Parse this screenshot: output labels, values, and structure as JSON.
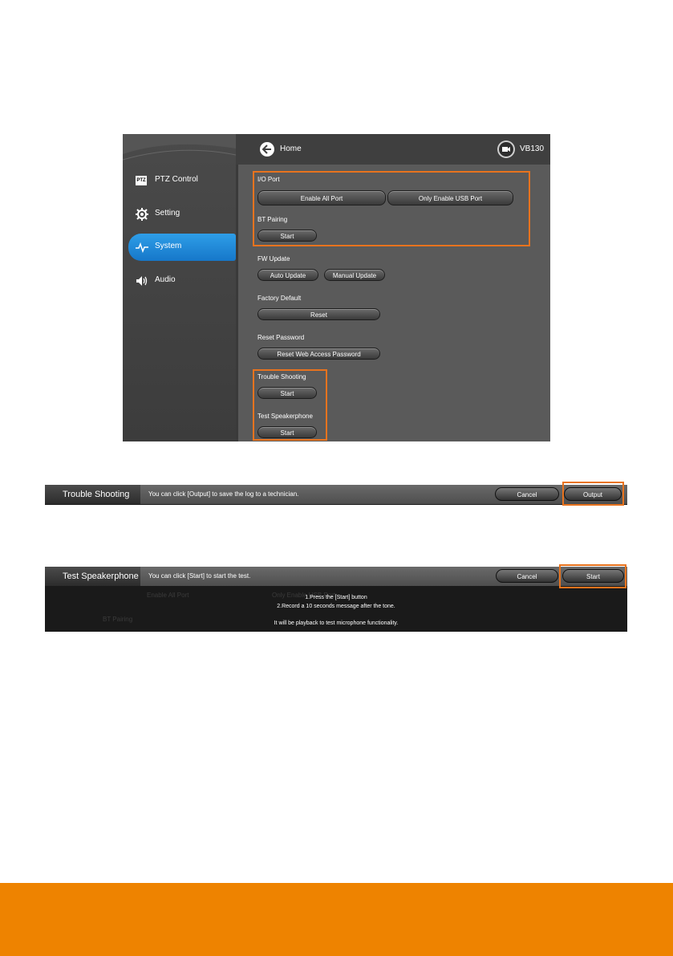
{
  "app": {
    "sidebar": {
      "items": [
        {
          "label": "PTZ Control",
          "icon": "ptz-icon"
        },
        {
          "label": "Setting",
          "icon": "gear-icon"
        },
        {
          "label": "System",
          "icon": "pulse-icon",
          "active": true
        },
        {
          "label": "Audio",
          "icon": "speaker-icon"
        }
      ],
      "ptz_badge": "PTZ"
    },
    "topbar": {
      "home_label": "Home",
      "model": "VB130"
    },
    "io_port": {
      "title": "I/O Port",
      "enable_all": "Enable All Port",
      "only_usb": "Only Enable USB Port"
    },
    "bt_pairing": {
      "title": "BT Pairing",
      "start": "Start"
    },
    "fw_update": {
      "title": "FW Update",
      "auto": "Auto Update",
      "manual": "Manual Update"
    },
    "factory_default": {
      "title": "Factory Default",
      "reset": "Reset"
    },
    "reset_password": {
      "title": "Reset Password",
      "button": "Reset Web Access Password"
    },
    "trouble_shooting": {
      "title": "Trouble Shooting",
      "start": "Start"
    },
    "test_speakerphone": {
      "title": "Test Speakerphone",
      "start": "Start"
    },
    "highlight_color": "#e8731e",
    "active_color": "#1f8ad8"
  },
  "trouble_dialog": {
    "title": "Trouble Shooting",
    "message": "You can click [Output] to save the log to a technician.",
    "cancel": "Cancel",
    "output": "Output"
  },
  "speaker_dialog": {
    "title": "Test Speakerphone",
    "message": "You can click [Start] to start the test.",
    "cancel": "Cancel",
    "start": "Start",
    "instructions": [
      "1.Press the [Start] button",
      "2.Record a 10 seconds message after the tone.",
      "It will be playback to test microphone functionality."
    ],
    "ghost_enable_all": "Enable All Port",
    "ghost_only_usb": "Only Enable USB Port",
    "ghost_bt": "BT Pairing"
  },
  "footer_color": "#ee8300"
}
